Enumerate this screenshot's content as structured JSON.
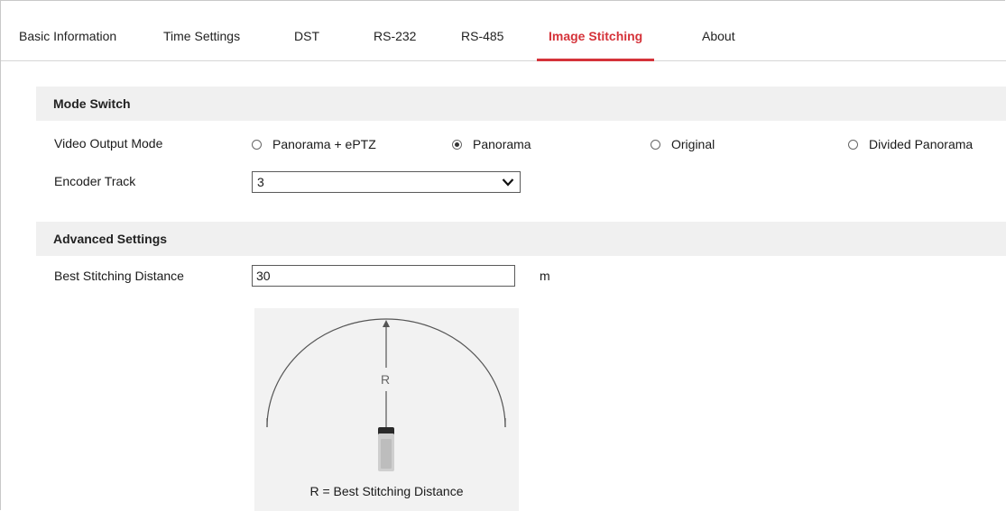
{
  "tabs": [
    {
      "label": "Basic Information",
      "active": false
    },
    {
      "label": "Time Settings",
      "active": false
    },
    {
      "label": "DST",
      "active": false
    },
    {
      "label": "RS-232",
      "active": false
    },
    {
      "label": "RS-485",
      "active": false
    },
    {
      "label": "Image Stitching",
      "active": true
    },
    {
      "label": "About",
      "active": false
    }
  ],
  "mode_switch": {
    "header": "Mode Switch",
    "video_output_mode": {
      "label": "Video Output Mode",
      "options": [
        {
          "label": "Panorama + ePTZ",
          "checked": false
        },
        {
          "label": "Panorama",
          "checked": true
        },
        {
          "label": "Original",
          "checked": false
        },
        {
          "label": "Divided Panorama",
          "checked": false
        }
      ]
    },
    "encoder_track": {
      "label": "Encoder Track",
      "value": "3"
    }
  },
  "advanced_settings": {
    "header": "Advanced Settings",
    "best_stitching_distance": {
      "label": "Best Stitching Distance",
      "value": "30",
      "unit": "m"
    },
    "diagram": {
      "r_label": "R",
      "caption": "R = Best Stitching Distance"
    }
  },
  "colors": {
    "active_tab": "#d5333a",
    "section_bg": "#f0f0f0",
    "diagram_bg": "#f2f2f2"
  }
}
